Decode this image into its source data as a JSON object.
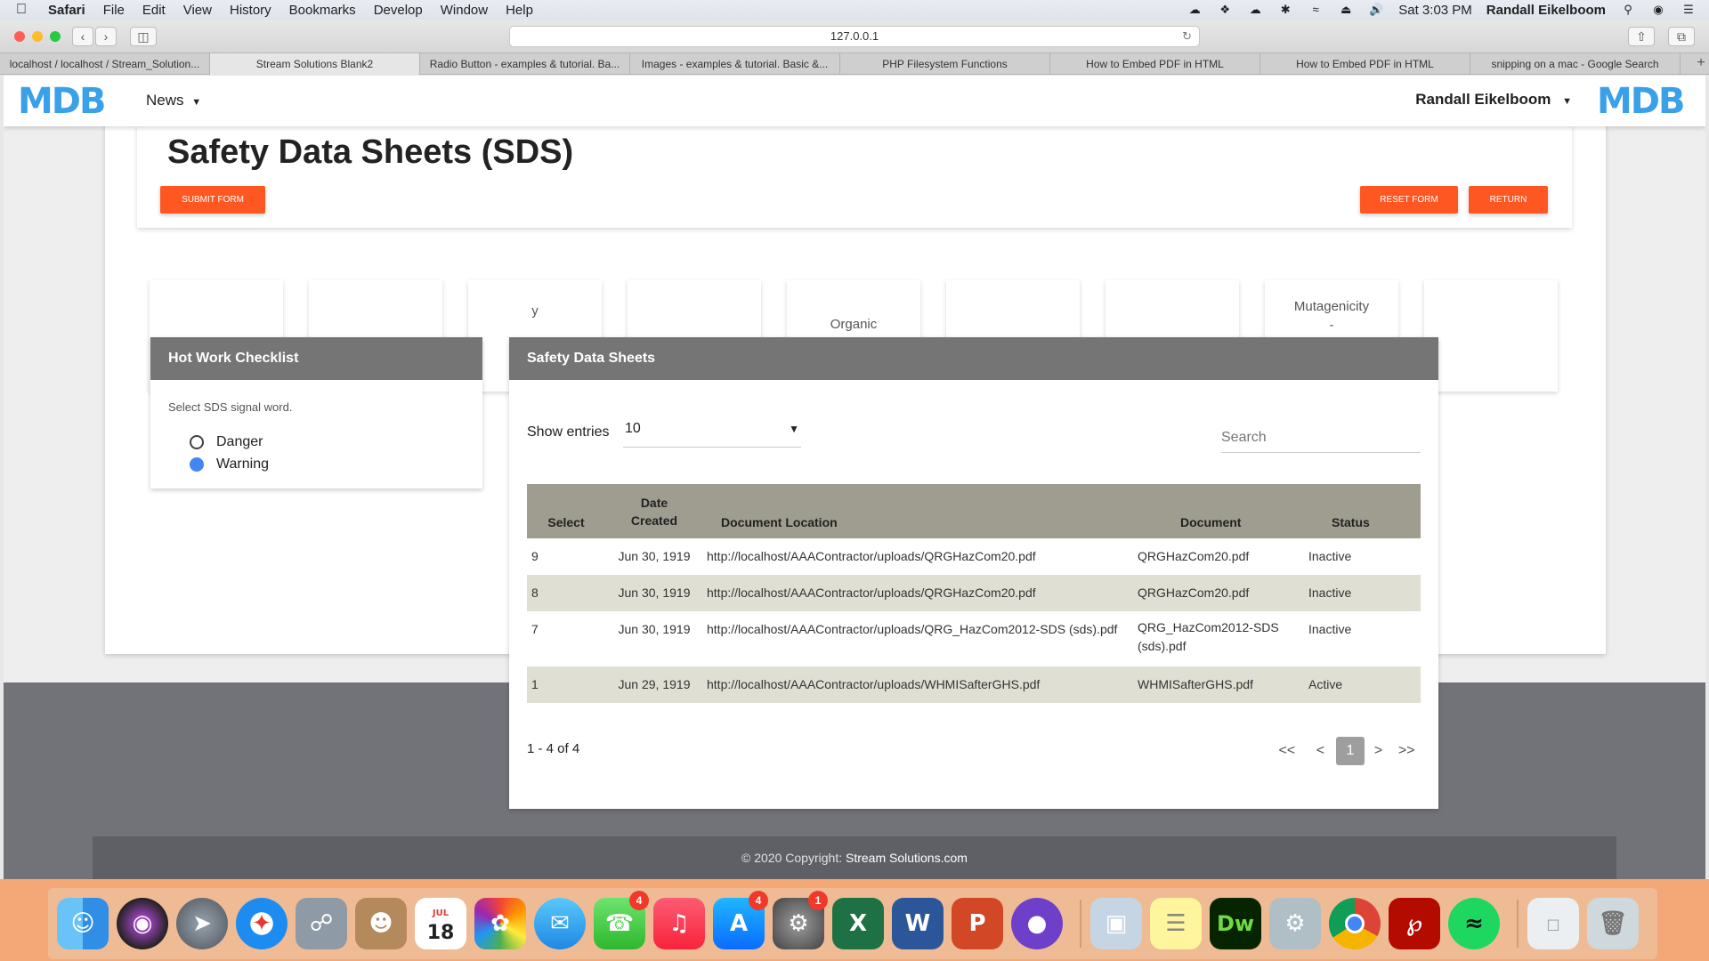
{
  "menubar": {
    "app": "Safari",
    "items": [
      "File",
      "Edit",
      "View",
      "History",
      "Bookmarks",
      "Develop",
      "Window",
      "Help"
    ],
    "clock": "Sat 3:03 PM",
    "user": "Randall Eikelboom"
  },
  "browser": {
    "url": "127.0.0.1",
    "tabs": [
      "localhost / localhost / Stream_Solution...",
      "Stream Solutions Blank2",
      "Radio Button - examples & tutorial. Ba...",
      "Images - examples & tutorial. Basic &...",
      "PHP Filesystem Functions",
      "How to Embed PDF in HTML",
      "How to Embed PDF in HTML",
      "snipping on a mac - Google Search"
    ]
  },
  "navbar": {
    "logo": "MDB",
    "news": "News",
    "user": "Randall Eikelboom"
  },
  "header": {
    "title": "Safety Data Sheets (SDS)",
    "submit": "SUBMIT FORM",
    "reset": "RESET FORM",
    "return": "RETURN"
  },
  "pictograms": [
    {
      "text": ""
    },
    {
      "text": ""
    },
    {
      "text": "y"
    },
    {
      "text": ""
    },
    {
      "text": "Organic\nPeroxides"
    },
    {
      "text": ""
    },
    {
      "text": ""
    },
    {
      "text": "Mutagenicity\n-\nAspiration\nToxicity"
    },
    {
      "text": ""
    }
  ],
  "checklist": {
    "title": "Hot Work Checklist",
    "prompt": "Select SDS signal word.",
    "options": [
      {
        "label": "Danger",
        "selected": false
      },
      {
        "label": "Warning",
        "selected": true
      }
    ]
  },
  "sds": {
    "title": "Safety Data Sheets",
    "show_entries_label": "Show entries",
    "entries_value": "10",
    "search_placeholder": "Search",
    "columns": {
      "select": "Select",
      "date_line1": "Date",
      "date_line2": "Created",
      "location": "Document Location",
      "document": "Document",
      "status": "Status"
    },
    "rows": [
      {
        "id": "9",
        "date": "Jun 30, 1919",
        "location": "http://localhost/AAAContractor/uploads/QRGHazCom20.pdf",
        "document": "QRGHazCom20.pdf",
        "status": "Inactive"
      },
      {
        "id": "8",
        "date": "Jun 30, 1919",
        "location": "http://localhost/AAAContractor/uploads/QRGHazCom20.pdf",
        "document": "QRGHazCom20.pdf",
        "status": "Inactive"
      },
      {
        "id": "7",
        "date": "Jun 30, 1919",
        "location": "http://localhost/AAAContractor/uploads/QRG_HazCom2012-SDS (sds).pdf",
        "document": "QRG_HazCom2012-SDS (sds).pdf",
        "status": "Inactive"
      },
      {
        "id": "1",
        "date": "Jun 29, 1919",
        "location": "http://localhost/AAAContractor/uploads/WHMISafterGHS.pdf",
        "document": "WHMISafterGHS.pdf",
        "status": "Active"
      }
    ],
    "range_text": "1 - 4 of 4",
    "pagination": {
      "first": "<<",
      "prev": "<",
      "current": "1",
      "next": ">",
      "last": ">>"
    }
  },
  "footer": {
    "copyright": "© 2020 Copyright:",
    "company": "Stream Solutions.com"
  },
  "dock": {
    "calendar_month": "JUL",
    "calendar_day": "18",
    "badges": {
      "facetime": "4",
      "appstore": "4",
      "sysprefs": "1"
    },
    "excel_letter": "X",
    "word_letter": "W",
    "ppt_letter": "P",
    "dw_label": "Dw"
  }
}
